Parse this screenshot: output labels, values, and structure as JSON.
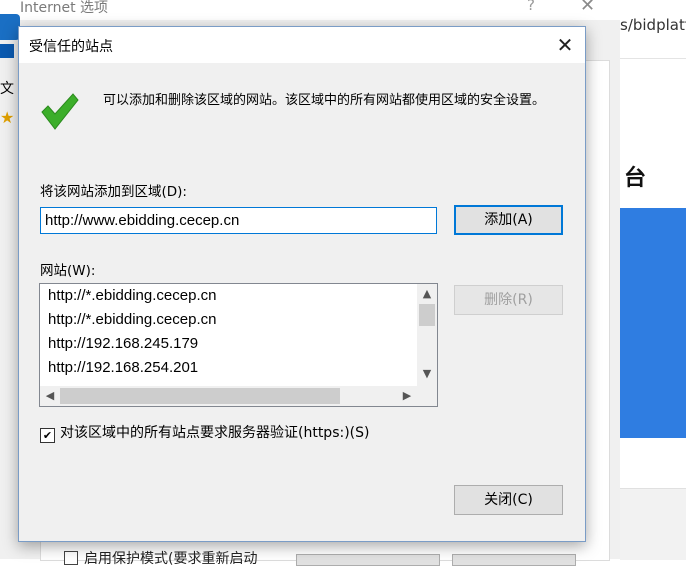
{
  "background_window": {
    "title": "Internet 选项",
    "help": "?",
    "close": "✕",
    "left_char": "文",
    "protected_mode_label": "启用保护模式(要求重新启动"
  },
  "browser": {
    "url_fragment": "s/bidplatf",
    "heading_fragment": "台"
  },
  "dialog": {
    "title": "受信任的站点",
    "close": "✕",
    "info_text": "可以添加和删除该区域的网站。该区域中的所有网站都使用区域的安全设置。",
    "add_label": "将该网站添加到区域(D):",
    "url_value": "http://www.ebidding.cecep.cn",
    "add_button": "添加(A)",
    "sites_label": "网站(W):",
    "sites": [
      "http://*.ebidding.cecep.cn",
      "http://*.ebidding.cecep.cn",
      "http://192.168.245.179",
      "http://192.168.254.201"
    ],
    "remove_button": "删除(R)",
    "https_checked": true,
    "https_label": "对该区域中的所有站点要求服务器验证(https:)(S)",
    "close_button": "关闭(C)"
  },
  "colors": {
    "accent": "#0078d7",
    "check_green": "#3cae2a"
  },
  "icons": {
    "check": "check-icon",
    "close": "close-icon"
  }
}
